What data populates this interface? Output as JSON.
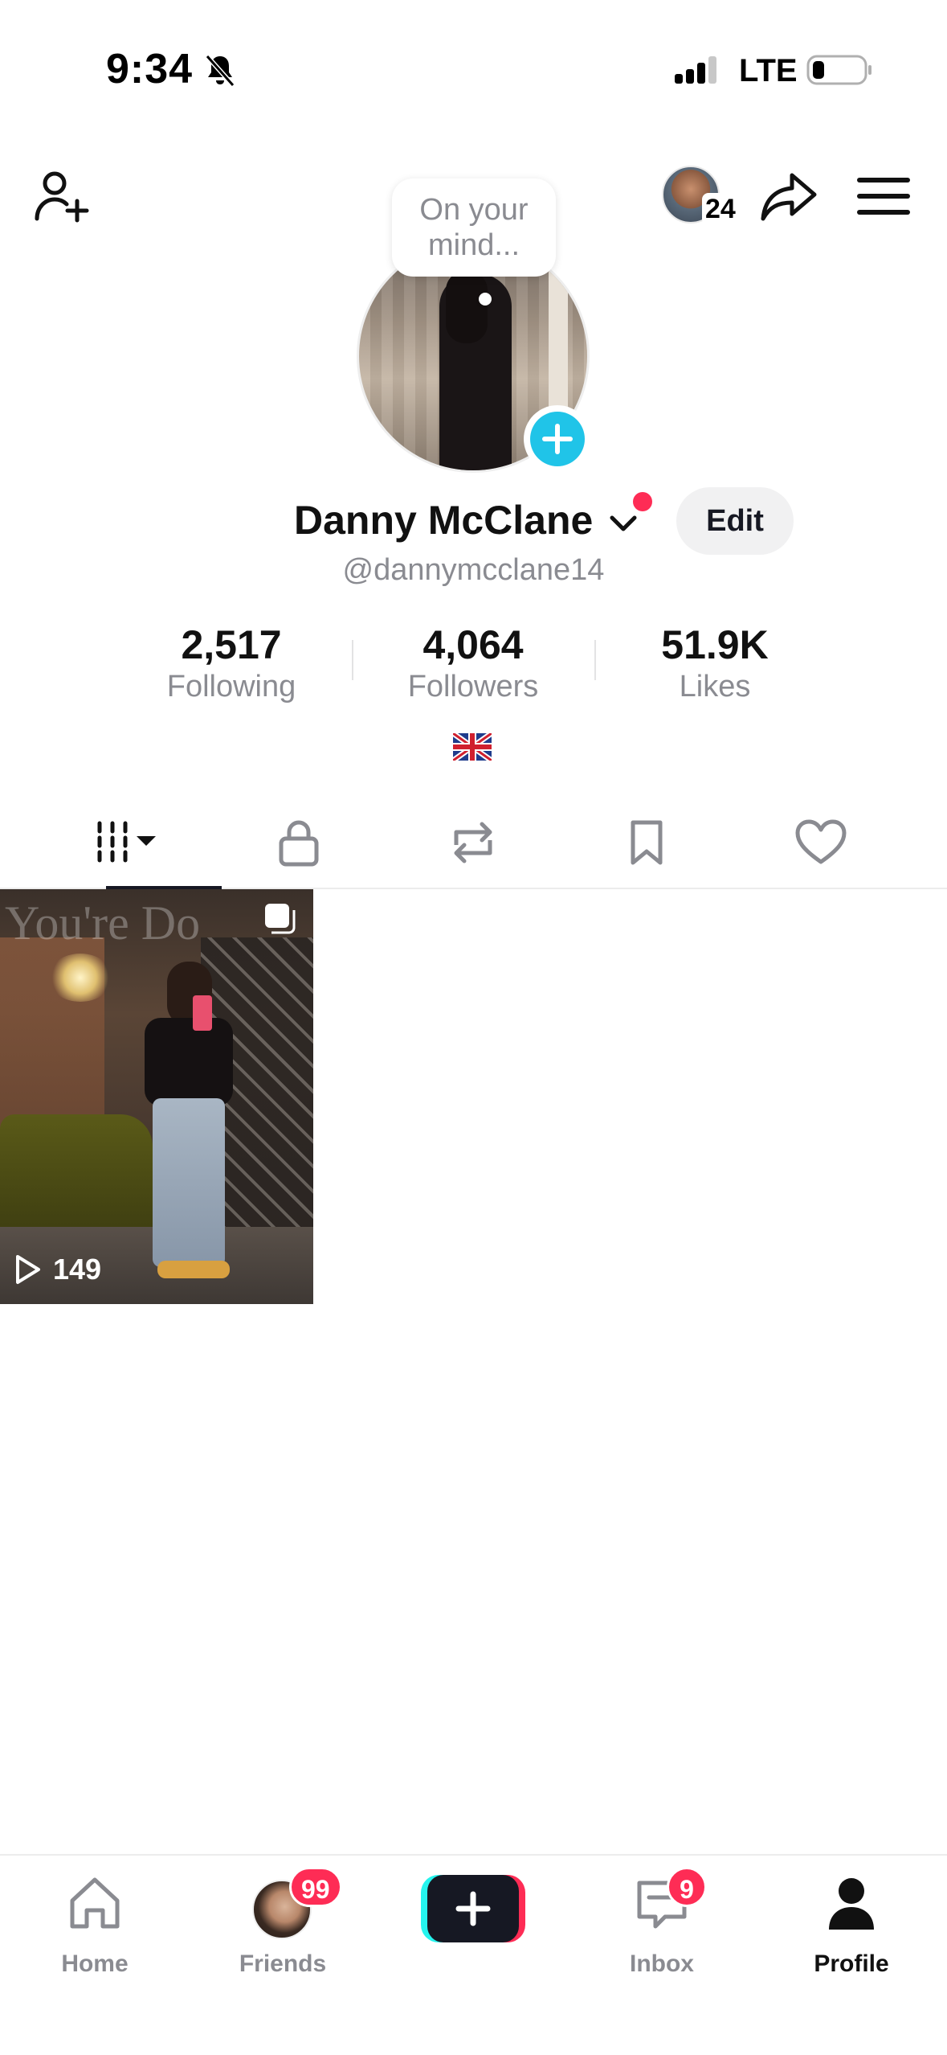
{
  "status_bar": {
    "time": "9:34",
    "carrier": "LTE",
    "icons": [
      "bell-slash-icon",
      "signal-icon",
      "battery-icon"
    ]
  },
  "top_bar": {
    "icons": [
      "add-friend-icon",
      "share-icon",
      "menu-icon"
    ],
    "viewer_count": "24"
  },
  "profile": {
    "note": "On your mind...",
    "display_name": "Danny McClane",
    "username": "@dannymcclane14",
    "edit_label": "Edit",
    "flag": "united-kingdom-flag",
    "stats": [
      {
        "value": "2,517",
        "label": "Following"
      },
      {
        "value": "4,064",
        "label": "Followers"
      },
      {
        "value": "51.9K",
        "label": "Likes"
      }
    ]
  },
  "tabs": {
    "items": [
      "videos-grid-icon",
      "lock-icon",
      "repost-icon",
      "bookmark-icon",
      "heart-icon"
    ],
    "active": "videos-grid-icon"
  },
  "videos": [
    {
      "play_count": "149",
      "sign_text": "You're Do"
    }
  ],
  "bottom_nav": {
    "home_label": "Home",
    "friends_label": "Friends",
    "friends_badge": "99",
    "inbox_label": "Inbox",
    "inbox_badge": "9",
    "profile_label": "Profile",
    "active": "Profile"
  },
  "colors": {
    "accent_red": "#fe2c55",
    "accent_cyan": "#25f4ee",
    "avatar_add": "#20c4e8",
    "muted_text": "#8a8b91",
    "dark": "#161823"
  }
}
